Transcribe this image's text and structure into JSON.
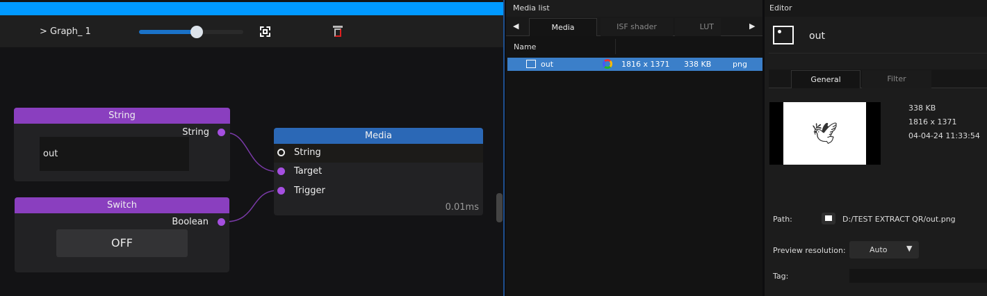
{
  "graph": {
    "title": "> Graph_ 1",
    "zoom_percent": 55,
    "nodes": {
      "string": {
        "title": "String",
        "output": "String",
        "value": "out"
      },
      "switch": {
        "title": "Switch",
        "output": "Boolean",
        "value": "OFF"
      },
      "media": {
        "title": "Media",
        "inputs": [
          "String",
          "Target",
          "Trigger"
        ],
        "time": "0.01ms"
      }
    }
  },
  "media_list": {
    "title": "Media list",
    "tabs": [
      "Media",
      "ISF shader",
      "LUT"
    ],
    "column": "Name",
    "rows": [
      {
        "name": "out",
        "resolution": "1816 x 1371",
        "size": "338 KB",
        "type": "png"
      }
    ]
  },
  "editor": {
    "title": "Editor",
    "name": "out",
    "tabs": [
      "General",
      "Filter"
    ],
    "info": {
      "size": "338 KB",
      "resolution": "1816 x 1371",
      "date": "04-04-24 11:33:54"
    },
    "path_label": "Path:",
    "path": "D:/TEST EXTRACT QR/out.png",
    "preview_label": "Preview resolution:",
    "preview_value": "Auto",
    "tag_label": "Tag:",
    "tag_value": ""
  },
  "colors": {
    "accent": "#0099ff",
    "node_purple": "#8a3fbf",
    "node_blue": "#2b68b6",
    "selection": "#3b7fc9"
  }
}
